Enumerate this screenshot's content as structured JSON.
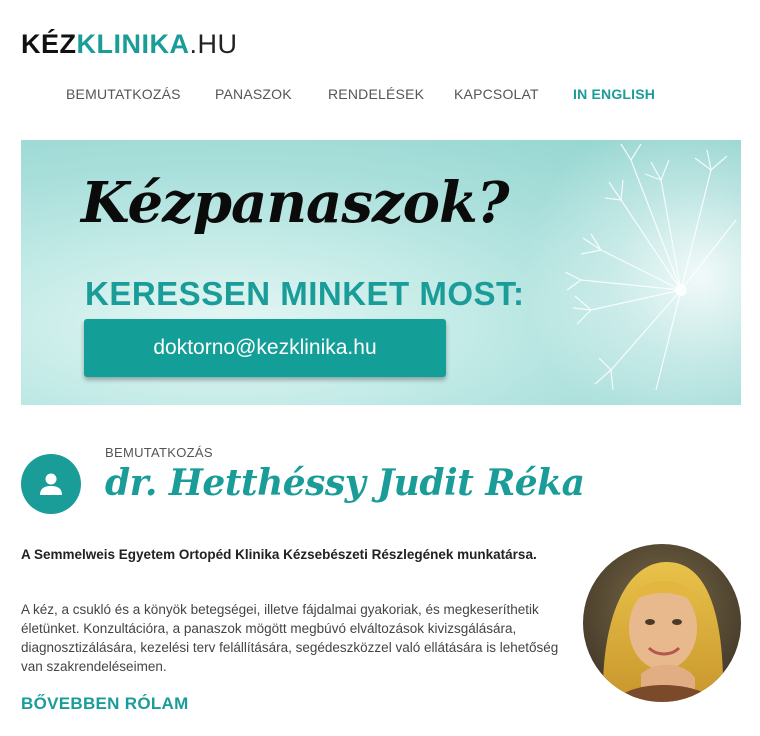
{
  "logo": {
    "part1": "KÉZ",
    "part2": "KLINIKA",
    "part3": ".HU"
  },
  "nav": {
    "items": [
      {
        "label": "BEMUTATKOZÁS"
      },
      {
        "label": "PANASZOK"
      },
      {
        "label": "RENDELÉSEK"
      },
      {
        "label": "KAPCSOLAT"
      },
      {
        "label": "IN ENGLISH"
      }
    ]
  },
  "hero": {
    "headline": "Kézpanaszok?",
    "subheadline": "KERESSEN MINKET MOST:",
    "email": "doktorno@kezklinika.hu"
  },
  "intro": {
    "kicker": "BEMUTATKOZÁS",
    "name": "dr. Hetthéssy Judit Réka",
    "lead": "A Semmelweis Egyetem Ortopéd Klinika Kézsebészeti Részlegének munkatársa.",
    "body": "A kéz, a csukló és a könyök betegségei, illetve fájdalmai gyakoriak, és megkeseríthetik életünket. Konzultációra, a panaszok mögött megbúvó elváltozások kivizsgálására, diagnosztizálására, kezelési terv felállítására, segédeszközzel való ellátására is lehetőség van szakrendeléseimen.",
    "more_link": "BŐVEBBEN RÓLAM"
  },
  "colors": {
    "accent": "#1a9c98",
    "button": "#139e97",
    "text": "#333333"
  },
  "icons": {
    "avatar": "user-icon"
  }
}
